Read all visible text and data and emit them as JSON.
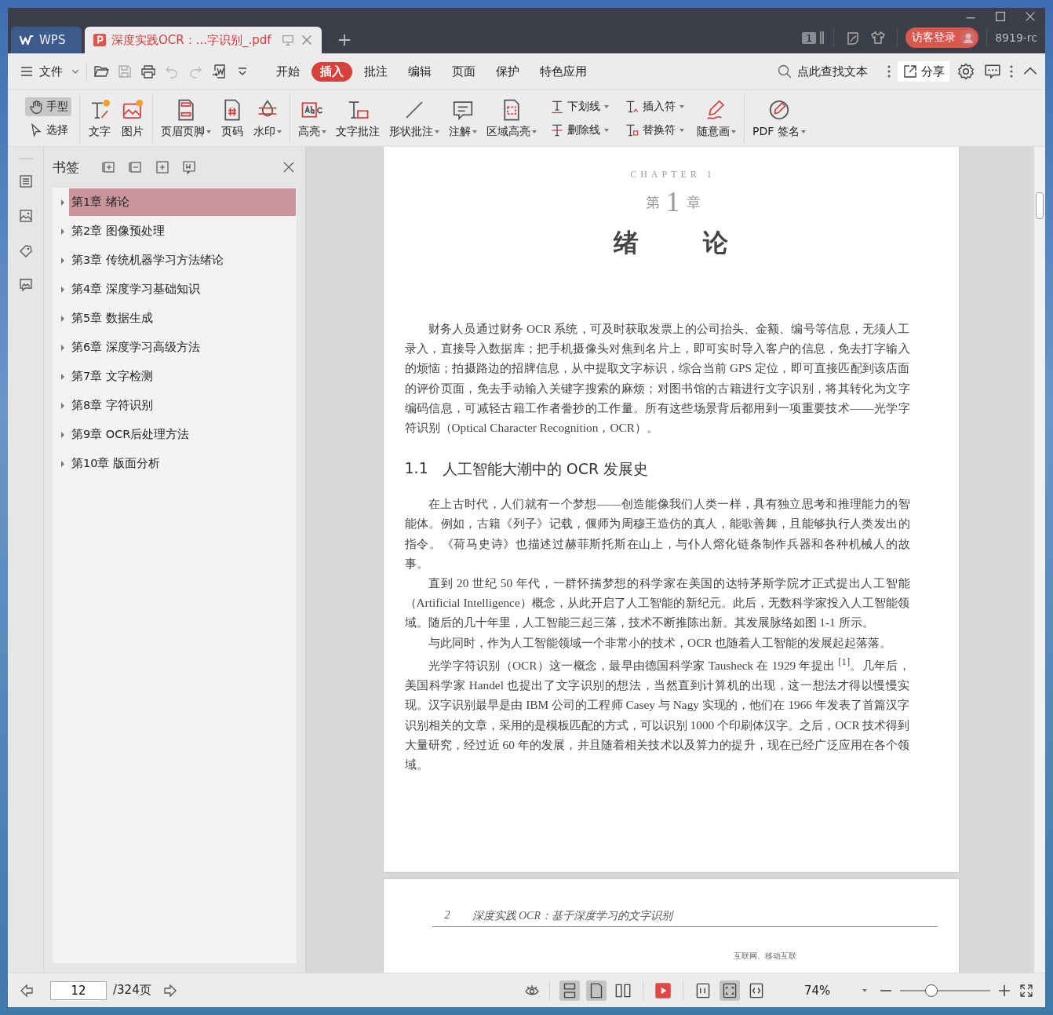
{
  "tabs": [
    {
      "label": "WPS",
      "kind": "home",
      "selected": false
    },
    {
      "label": "深度实践OCR：...字识别_.pdf",
      "kind": "document",
      "selected": true
    }
  ],
  "title_bar": {
    "page_badge": "1",
    "login": "访客登录",
    "user": "8919-rc"
  },
  "menu": {
    "file": "文件",
    "tabs": [
      {
        "label": "开始",
        "selected": false
      },
      {
        "label": "插入",
        "selected": true
      },
      {
        "label": "批注",
        "selected": false
      },
      {
        "label": "编辑",
        "selected": false
      },
      {
        "label": "页面",
        "selected": false
      },
      {
        "label": "保护",
        "selected": false
      },
      {
        "label": "特色应用",
        "selected": false
      }
    ],
    "search": {
      "placeholder": "点此查找文本"
    },
    "share": "分享"
  },
  "ribbon": {
    "groups": [
      {
        "items": [
          {
            "kind": "stack",
            "tools": [
              {
                "label": "手型",
                "dropdown": false,
                "selected": true
              },
              {
                "label": "选择",
                "dropdown": false,
                "selected": false
              }
            ]
          }
        ]
      },
      {
        "items": [
          {
            "kind": "large",
            "label": "文字",
            "dropdown": false
          },
          {
            "kind": "large",
            "label": "图片",
            "dropdown": false
          }
        ]
      },
      {
        "items": [
          {
            "kind": "large",
            "label": "页眉页脚",
            "dropdown": true
          },
          {
            "kind": "large",
            "label": "页码",
            "dropdown": false
          },
          {
            "kind": "large",
            "label": "水印",
            "dropdown": true
          }
        ]
      },
      {
        "items": [
          {
            "kind": "large",
            "label": "高亮",
            "dropdown": true
          },
          {
            "kind": "large",
            "label": "文字批注",
            "dropdown": false
          },
          {
            "kind": "large",
            "label": "形状批注",
            "dropdown": true
          },
          {
            "kind": "large",
            "label": "注解",
            "dropdown": true
          },
          {
            "kind": "large",
            "label": "区域高亮",
            "dropdown": true
          },
          {
            "kind": "stack",
            "tools": [
              {
                "label": "下划线",
                "dropdown": true
              },
              {
                "label": "删除线",
                "dropdown": true
              }
            ]
          },
          {
            "kind": "stack",
            "tools": [
              {
                "label": "插入符",
                "dropdown": true
              },
              {
                "label": "替换符",
                "dropdown": true
              }
            ]
          },
          {
            "kind": "large",
            "label": "随意画",
            "dropdown": true
          }
        ]
      },
      {
        "items": [
          {
            "kind": "large",
            "label": "PDF 签名",
            "dropdown": true
          }
        ]
      }
    ]
  },
  "bookmarks": {
    "title": "书签",
    "items": [
      {
        "label": "第1章 绪论",
        "selected": true
      },
      {
        "label": "第2章 图像预处理",
        "selected": false
      },
      {
        "label": "第3章 传统机器学习方法绪论",
        "selected": false
      },
      {
        "label": "第4章 深度学习基础知识",
        "selected": false
      },
      {
        "label": "第5章 数据生成",
        "selected": false
      },
      {
        "label": "第6章 深度学习高级方法",
        "selected": false
      },
      {
        "label": "第7章 文字检测",
        "selected": false
      },
      {
        "label": "第8章 字符识别",
        "selected": false
      },
      {
        "label": "第9章 OCR后处理方法",
        "selected": false
      },
      {
        "label": "第10章 版面分析",
        "selected": false
      }
    ]
  },
  "document": {
    "page_1": {
      "chapter_label": "CHAPTER 1",
      "chapter_prefix": "第",
      "chapter_number": "1",
      "chapter_suffix": "章",
      "title": "绪　　论",
      "blocks": [
        {
          "kind": "paragraph",
          "text": "财务人员通过财务 OCR 系统，可及时获取发票上的公司抬头、金额、编号等信息，无须人工录入，直接导入数据库；把手机摄像头对焦到名片上，即可实时导入客户的信息，免去打字输入的烦恼；拍摄路边的招牌信息，从中提取文字标识，综合当前 GPS 定位，即可直接匹配到该店面的评价页面，免去手动输入关键字搜索的麻烦；对图书馆的古籍进行文字识别，将其转化为文字编码信息，可减轻古籍工作者誊抄的工作量。所有这些场景背后都用到一项重要技术——光学字符识别（Optical Character Recognition，OCR）。"
        },
        {
          "kind": "heading",
          "number": "1.1",
          "text": "人工智能大潮中的 OCR 发展史"
        },
        {
          "kind": "paragraph",
          "text": "在上古时代，人们就有一个梦想——创造能像我们人类一样，具有独立思考和推理能力的智能体。例如，古籍《列子》记载，偃师为周穆王造仿的真人，能歌善舞，且能够执行人类发出的指令。《荷马史诗》也描述过赫菲斯托斯在山上，与仆人熔化链条制作兵器和各种机械人的故事。"
        },
        {
          "kind": "paragraph",
          "text": "直到 20 世纪 50 年代，一群怀揣梦想的科学家在美国的达特茅斯学院才正式提出人工智能（Artificial Intelligence）概念，从此开启了人工智能的新纪元。此后，无数科学家投入人工智能领域。随后的几十年里，人工智能三起三落，技术不断推陈出新。其发展脉络如图 1-1 所示。"
        },
        {
          "kind": "paragraph",
          "text": "与此同时，作为人工智能领域一个非常小的技术，OCR 也随着人工智能的发展起起落落。"
        },
        {
          "kind": "paragraph",
          "text": "光学字符识别（OCR）这一概念，最早由德国科学家 Tausheck 在 1929 年提出 $^{[1]}$。几年后，美国科学家 Handel 也提出了文字识别的想法，当然直到计算机的出现，这一想法才得以慢慢实现。汉字识别最早是由 IBM 公司的工程师 Casey 与 Nagy 实现的，他们在 1966 年发表了首篇汉字识别相关的文章，采用的是模板匹配的方式，可以识别 1000 个印刷体汉字。之后，OCR 技术得到大量研究，经过近 60 年的发展，并且随着相关技术以及算力的提升，现在已经广泛应用在各个领域。"
        }
      ]
    },
    "page_2": {
      "header_number": "2",
      "header_title": "深度实践 OCR：基于深度学习的文字识别",
      "fragment": "互联网、移动互联"
    }
  },
  "status_bar": {
    "page_input": "12",
    "page_total": "/324页",
    "view_modes": [
      {
        "selected": true
      },
      {
        "selected": true
      },
      {
        "selected": false
      }
    ],
    "fit_modes": [
      {
        "selected": false
      },
      {
        "selected": true
      },
      {
        "selected": false
      }
    ],
    "zoom": "74%",
    "zoom_slider": {
      "level": 0.35
    }
  }
}
